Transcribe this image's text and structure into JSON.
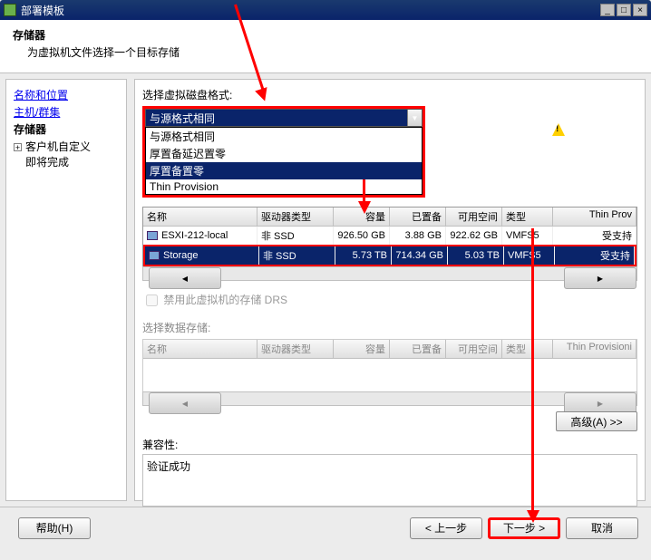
{
  "window": {
    "title": "部署模板"
  },
  "header": {
    "title": "存储器",
    "subtitle": "为虚拟机文件选择一个目标存储"
  },
  "sidebar": {
    "items": [
      {
        "label": "名称和位置",
        "link": true
      },
      {
        "label": "主机/群集",
        "link": true
      },
      {
        "label": "存储器",
        "current": true
      },
      {
        "label": "客户机自定义",
        "expandable": true
      },
      {
        "label": "即将完成",
        "plain": true
      }
    ]
  },
  "diskFormat": {
    "label": "选择虚拟磁盘格式:",
    "selected": "与源格式相同",
    "options": [
      "与源格式相同",
      "厚置备延迟置零",
      "厚置备置零",
      "Thin Provision"
    ]
  },
  "table1": {
    "headers": [
      "名称",
      "驱动器类型",
      "容量",
      "已置备",
      "可用空间",
      "类型",
      "Thin Prov"
    ],
    "rows": [
      {
        "name": "ESXI-212-local",
        "drive": "非 SSD",
        "cap": "926.50 GB",
        "prov": "3.88 GB",
        "free": "922.62 GB",
        "type": "VMFS5",
        "thin": "受支持"
      },
      {
        "name": "Storage",
        "drive": "非 SSD",
        "cap": "5.73 TB",
        "prov": "714.34 GB",
        "free": "5.03 TB",
        "type": "VMFS5",
        "thin": "受支持",
        "highlight": true
      }
    ]
  },
  "checkbox": {
    "label": "禁用此虚拟机的存储 DRS"
  },
  "table2": {
    "label": "选择数据存储:",
    "headers": [
      "名称",
      "驱动器类型",
      "容量",
      "已置备",
      "可用空间",
      "类型",
      "Thin Provisioni"
    ]
  },
  "advancedBtn": "高级(A) >>",
  "compat": {
    "label": "兼容性:",
    "text": "验证成功"
  },
  "footer": {
    "help": "帮助(H)",
    "back": "< 上一步",
    "next": "下一步 >",
    "cancel": "取消"
  }
}
